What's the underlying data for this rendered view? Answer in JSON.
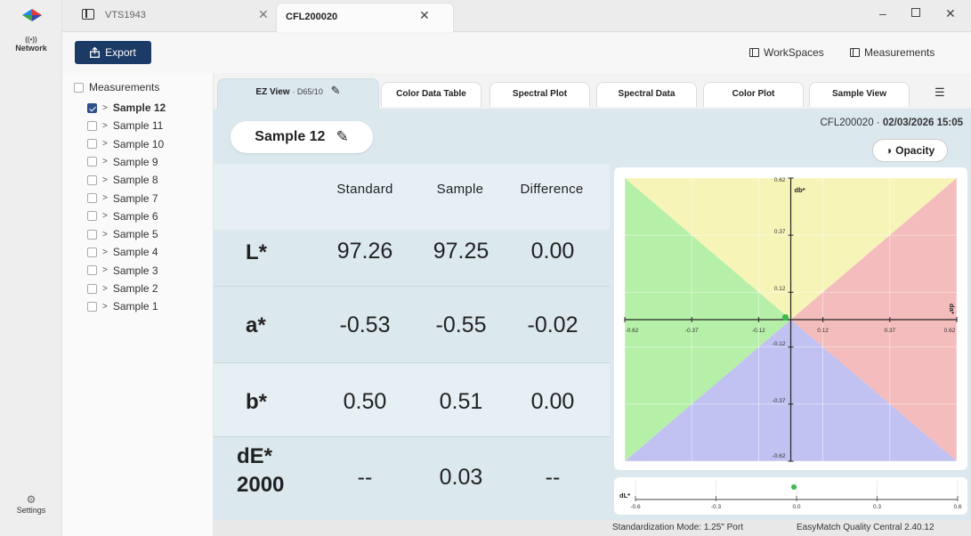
{
  "rail": {
    "network_label": "Network",
    "settings_label": "Settings"
  },
  "titlebar": {
    "tabs": [
      {
        "label": "VTS1943"
      },
      {
        "label": "CFL200020"
      }
    ]
  },
  "toolbar": {
    "export_label": "Export",
    "workspaces_label": "WorkSpaces",
    "measurements_label": "Measurements"
  },
  "tree": {
    "root_label": "Measurements",
    "items": [
      {
        "label": "Sample 12",
        "checked": true
      },
      {
        "label": "Sample 11",
        "checked": false
      },
      {
        "label": "Sample 10",
        "checked": false
      },
      {
        "label": "Sample 9",
        "checked": false
      },
      {
        "label": "Sample 8",
        "checked": false
      },
      {
        "label": "Sample 7",
        "checked": false
      },
      {
        "label": "Sample 6",
        "checked": false
      },
      {
        "label": "Sample 5",
        "checked": false
      },
      {
        "label": "Sample 4",
        "checked": false
      },
      {
        "label": "Sample 3",
        "checked": false
      },
      {
        "label": "Sample 2",
        "checked": false
      },
      {
        "label": "Sample 1",
        "checked": false
      }
    ]
  },
  "content_tabs": {
    "ez_view": "EZ View",
    "ez_view_sub": "· D65/10",
    "color_data_table": "Color Data Table",
    "spectral_plot": "Spectral Plot",
    "spectral_data": "Spectral Data",
    "color_plot": "Color Plot",
    "sample_view": "Sample View"
  },
  "panel": {
    "sample_name": "Sample 12",
    "stamp_id": "CFL200020 · ",
    "stamp_datetime": "02/03/2026 15:05",
    "opacity_label": "Opacity"
  },
  "table": {
    "headers": [
      "Standard",
      "Sample",
      "Difference"
    ],
    "rows": [
      {
        "label": "L*",
        "standard": "97.26",
        "sample": "97.25",
        "difference": "0.00"
      },
      {
        "label": "a*",
        "standard": "-0.53",
        "sample": "-0.55",
        "difference": "-0.02"
      },
      {
        "label": "b*",
        "standard": "0.50",
        "sample": "0.51",
        "difference": "0.00"
      },
      {
        "label": "dE* 2000",
        "standard": "--",
        "sample": "0.03",
        "difference": "--"
      }
    ]
  },
  "chart_data": [
    {
      "type": "scatter",
      "xlabel": "da*",
      "ylabel": "db*",
      "xlim": [
        -0.62,
        0.62
      ],
      "ylim": [
        -0.62,
        0.62
      ],
      "x_ticks": [
        "-0.62",
        "-0.37",
        "-0.12",
        "0.12",
        "0.37",
        "0.62"
      ],
      "y_ticks": [
        "0.62",
        "0.37",
        "0.12",
        "-0.12",
        "-0.37",
        "-0.62"
      ],
      "series": [
        {
          "x": [
            -0.02
          ],
          "y": [
            0.01
          ]
        }
      ],
      "grid": true,
      "colors": {
        "yellow": "#f7f4b8",
        "red": "#f4bcbc",
        "green": "#b6f0a8",
        "blue": "#c1c1f2",
        "point": "#3db84a"
      }
    },
    {
      "type": "scatter",
      "xlabel": "dL*",
      "xlim": [
        -0.6,
        0.6
      ],
      "x_ticks": [
        "-0.6",
        "-0.3",
        "0.0",
        "0.3",
        "0.6"
      ],
      "series": [
        {
          "x": [
            -0.01
          ]
        }
      ]
    }
  ],
  "footer": {
    "mode": "Standardization Mode: 1.25\" Port",
    "version": "EasyMatch Quality Central 2.40.12"
  }
}
